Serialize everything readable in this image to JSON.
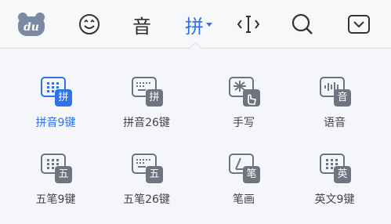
{
  "toolbar": {
    "items": [
      {
        "name": "du-logo",
        "label": "du"
      },
      {
        "name": "emoji",
        "label": ""
      },
      {
        "name": "voice",
        "label": "音"
      },
      {
        "name": "pinyin",
        "label": "拼"
      },
      {
        "name": "cursor",
        "label": ""
      },
      {
        "name": "search",
        "label": ""
      },
      {
        "name": "hide-keyboard",
        "label": ""
      }
    ]
  },
  "keyboards": [
    {
      "label": "拼音9键",
      "badge": "拼",
      "active": true
    },
    {
      "label": "拼音26键",
      "badge": "拼",
      "active": false
    },
    {
      "label": "手写",
      "badge": "",
      "active": false
    },
    {
      "label": "语音",
      "badge": "音",
      "active": false
    },
    {
      "label": "五笔9键",
      "badge": "五",
      "active": false
    },
    {
      "label": "五笔26键",
      "badge": "五",
      "active": false
    },
    {
      "label": "笔画",
      "badge": "笔",
      "active": false
    },
    {
      "label": "英文9键",
      "badge": "英",
      "active": false
    }
  ],
  "colors": {
    "accent": "#2f73e8",
    "icon": "#6e7580",
    "background": "#f4f6f9"
  }
}
